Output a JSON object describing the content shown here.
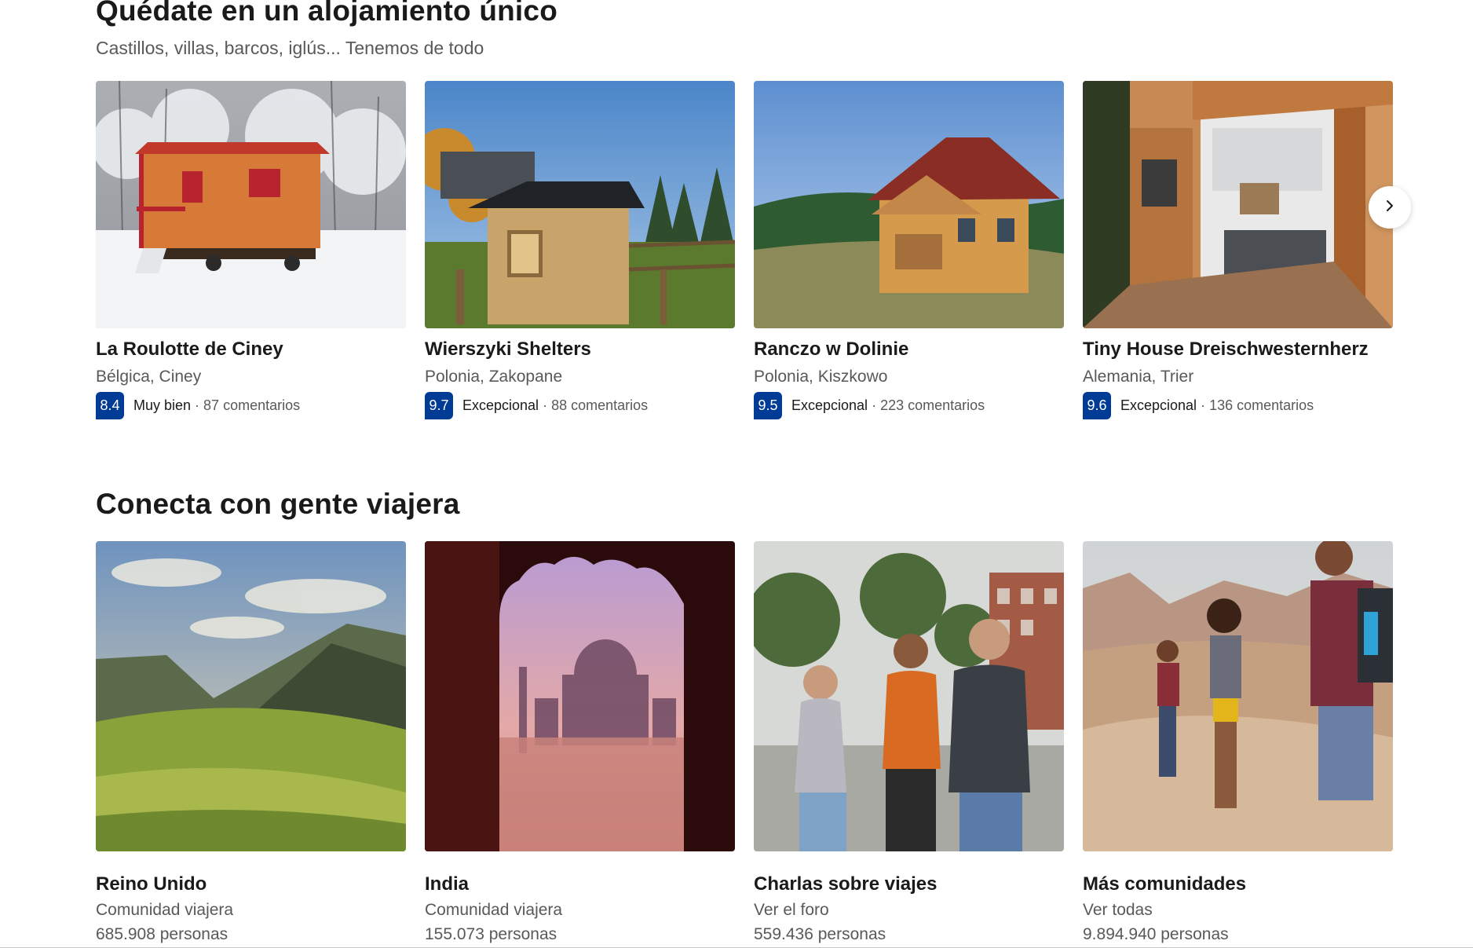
{
  "section_unique": {
    "title": "Quédate en un alojamiento único",
    "subtitle": "Castillos, villas, barcos, iglús... Tenemos de todo",
    "properties": [
      {
        "name": "La Roulotte de Ciney",
        "location": "Bélgica, Ciney",
        "score": "8.4",
        "rating_word": "Muy bien",
        "reviews": "87 comentarios"
      },
      {
        "name": "Wierszyki Shelters",
        "location": "Polonia, Zakopane",
        "score": "9.7",
        "rating_word": "Excepcional",
        "reviews": "88 comentarios"
      },
      {
        "name": "Ranczo w Dolinie",
        "location": "Polonia, Kiszkowo",
        "score": "9.5",
        "rating_word": "Excepcional",
        "reviews": "223 comentarios"
      },
      {
        "name": "Tiny House Dreischwesternherz",
        "location": "Alemania, Trier",
        "score": "9.6",
        "rating_word": "Excepcional",
        "reviews": "136 comentarios"
      }
    ],
    "next_icon": "chevron-right-icon",
    "separator": "·"
  },
  "section_community": {
    "title": "Conecta con gente viajera",
    "communities": [
      {
        "name": "Reino Unido",
        "subtitle": "Comunidad viajera",
        "count": "685.908 personas"
      },
      {
        "name": "India",
        "subtitle": "Comunidad viajera",
        "count": "155.073 personas"
      },
      {
        "name": "Charlas sobre viajes",
        "subtitle": "Ver el foro",
        "count": "559.436 personas"
      },
      {
        "name": "Más comunidades",
        "subtitle": "Ver todas",
        "count": "9.894.940 personas"
      }
    ]
  },
  "colors": {
    "score_badge": "#003b95",
    "text_primary": "#1a1a1a",
    "text_secondary": "#595959"
  }
}
